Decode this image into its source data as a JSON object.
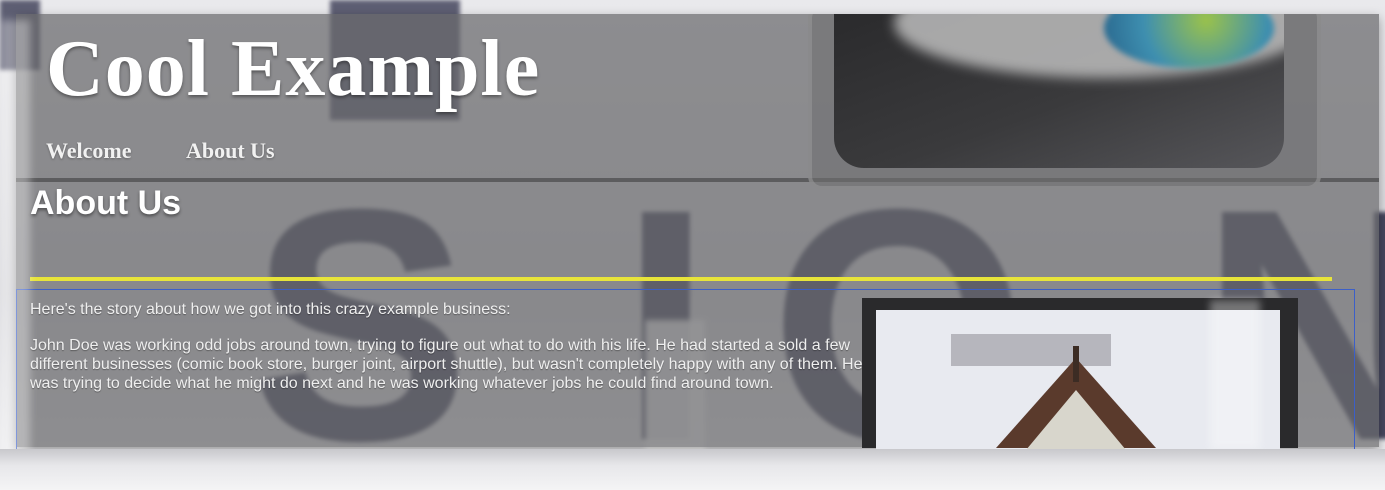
{
  "site": {
    "title": "Cool Example",
    "nav": [
      {
        "label": "Welcome"
      },
      {
        "label": "About Us"
      }
    ]
  },
  "page": {
    "heading": "About Us",
    "paragraphs": [
      "Here's the story about how we got into this crazy example business:",
      "John Doe was working odd jobs around town, trying to figure out what to do with his life. He had started a sold a few different businesses (comic book store, burger joint, airport shuttle), but wasn't completely happy with any of them. He was trying to decide what he might do next and he was working whatever jobs he could find around town."
    ]
  },
  "colors": {
    "accent_rule": "#e7e43a",
    "content_border": "#3c5fc8",
    "title_text": "#ffffff"
  },
  "background_letters": [
    "S",
    "I",
    "O",
    "N"
  ]
}
